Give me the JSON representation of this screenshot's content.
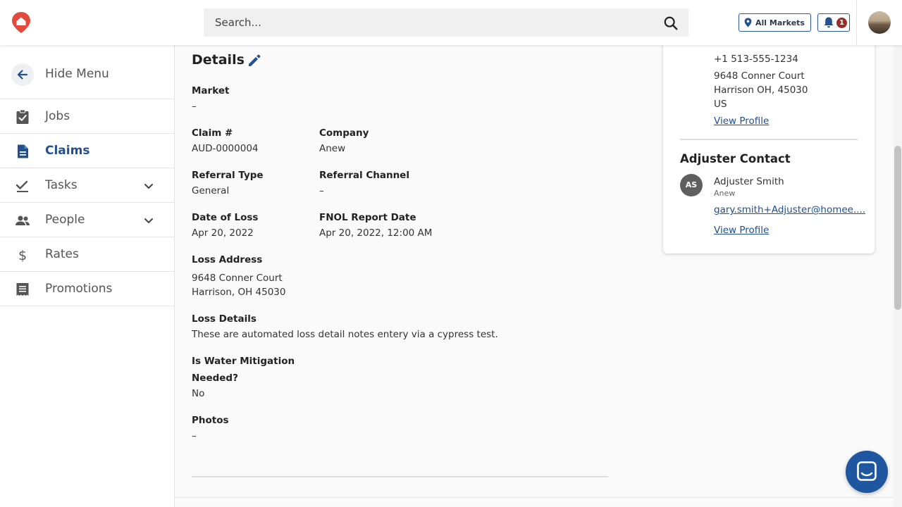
{
  "search": {
    "placeholder": "Search..."
  },
  "header": {
    "market_label": "All Markets",
    "notifications_count": "1"
  },
  "sidebar": {
    "hide_label": "Hide Menu",
    "items": [
      {
        "label": "Jobs"
      },
      {
        "label": "Claims"
      },
      {
        "label": "Tasks"
      },
      {
        "label": "People"
      },
      {
        "label": "Rates"
      },
      {
        "label": "Promotions"
      }
    ]
  },
  "details": {
    "title": "Details",
    "market_label": "Market",
    "market_value": "–",
    "claim_label": "Claim #",
    "claim_value": "AUD-0000004",
    "company_label": "Company",
    "company_value": "Anew",
    "referral_type_label": "Referral Type",
    "referral_type_value": "General",
    "referral_channel_label": "Referral Channel",
    "referral_channel_value": "–",
    "date_of_loss_label": "Date of Loss",
    "date_of_loss_value": "Apr 20, 2022",
    "fnol_label": "FNOL Report Date",
    "fnol_value": "Apr 20, 2022, 12:00 AM",
    "loss_address_label": "Loss Address",
    "loss_address_line1": "9648 Conner Court",
    "loss_address_line2": "Harrison, OH 45030",
    "loss_details_label": "Loss Details",
    "loss_details_value": "These are automated loss detail notes entery via a cypress test.",
    "water_label_line1": "Is Water Mitigation",
    "water_label_line2": "Needed?",
    "water_value": "No",
    "photos_label": "Photos",
    "photos_value": "–"
  },
  "contact_card": {
    "phone": "+1 513-555-1234",
    "address_line1": "9648 Conner Court",
    "address_line2": "Harrison OH, 45030",
    "address_line3": "US",
    "view_profile": "View Profile"
  },
  "adjuster": {
    "title": "Adjuster Contact",
    "initials": "AS",
    "name": "Adjuster Smith",
    "company": "Anew",
    "email": "gary.smith+Adjuster@homee....",
    "view_profile": "View Profile"
  },
  "colors": {
    "brand": "#e24b3b",
    "primary": "#23508e",
    "badge": "#9b2b26",
    "chat": "#1e57a0"
  },
  "icons": [
    "logo-icon",
    "search-icon",
    "location-pin-icon",
    "bell-icon",
    "arrow-back-icon",
    "clipboard-check-icon",
    "document-icon",
    "checkmark-icon",
    "people-icon",
    "dollar-icon",
    "receipt-icon",
    "chevron-down-icon",
    "pencil-icon",
    "chat-icon"
  ]
}
